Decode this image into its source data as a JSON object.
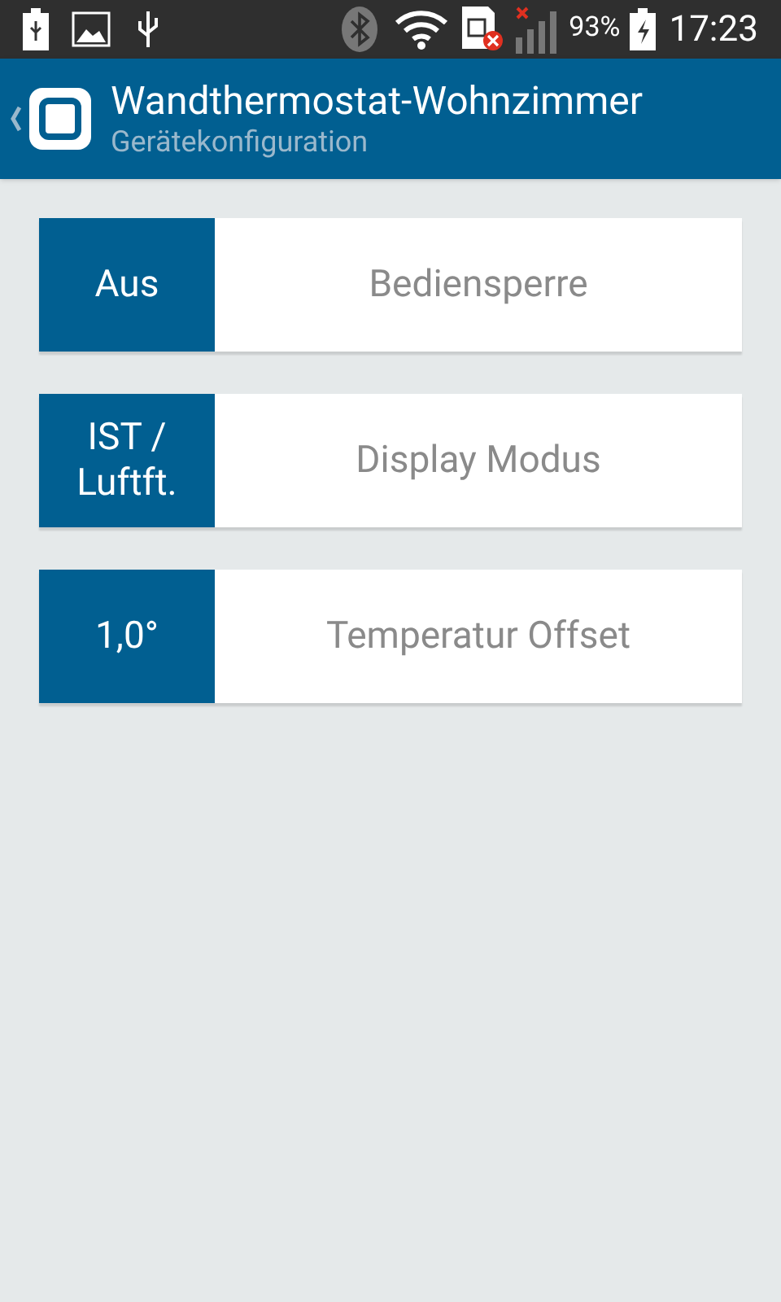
{
  "status_bar": {
    "battery_percent": "93%",
    "time": "17:23"
  },
  "header": {
    "title": "Wandthermostat-Wohnzimmer",
    "subtitle": "Gerätekonfiguration"
  },
  "settings": [
    {
      "value": "Aus",
      "label": "Bediensperre"
    },
    {
      "value": "IST / Luftft.",
      "label": "Display Modus"
    },
    {
      "value": "1,0°",
      "label": "Temperatur Offset"
    }
  ]
}
